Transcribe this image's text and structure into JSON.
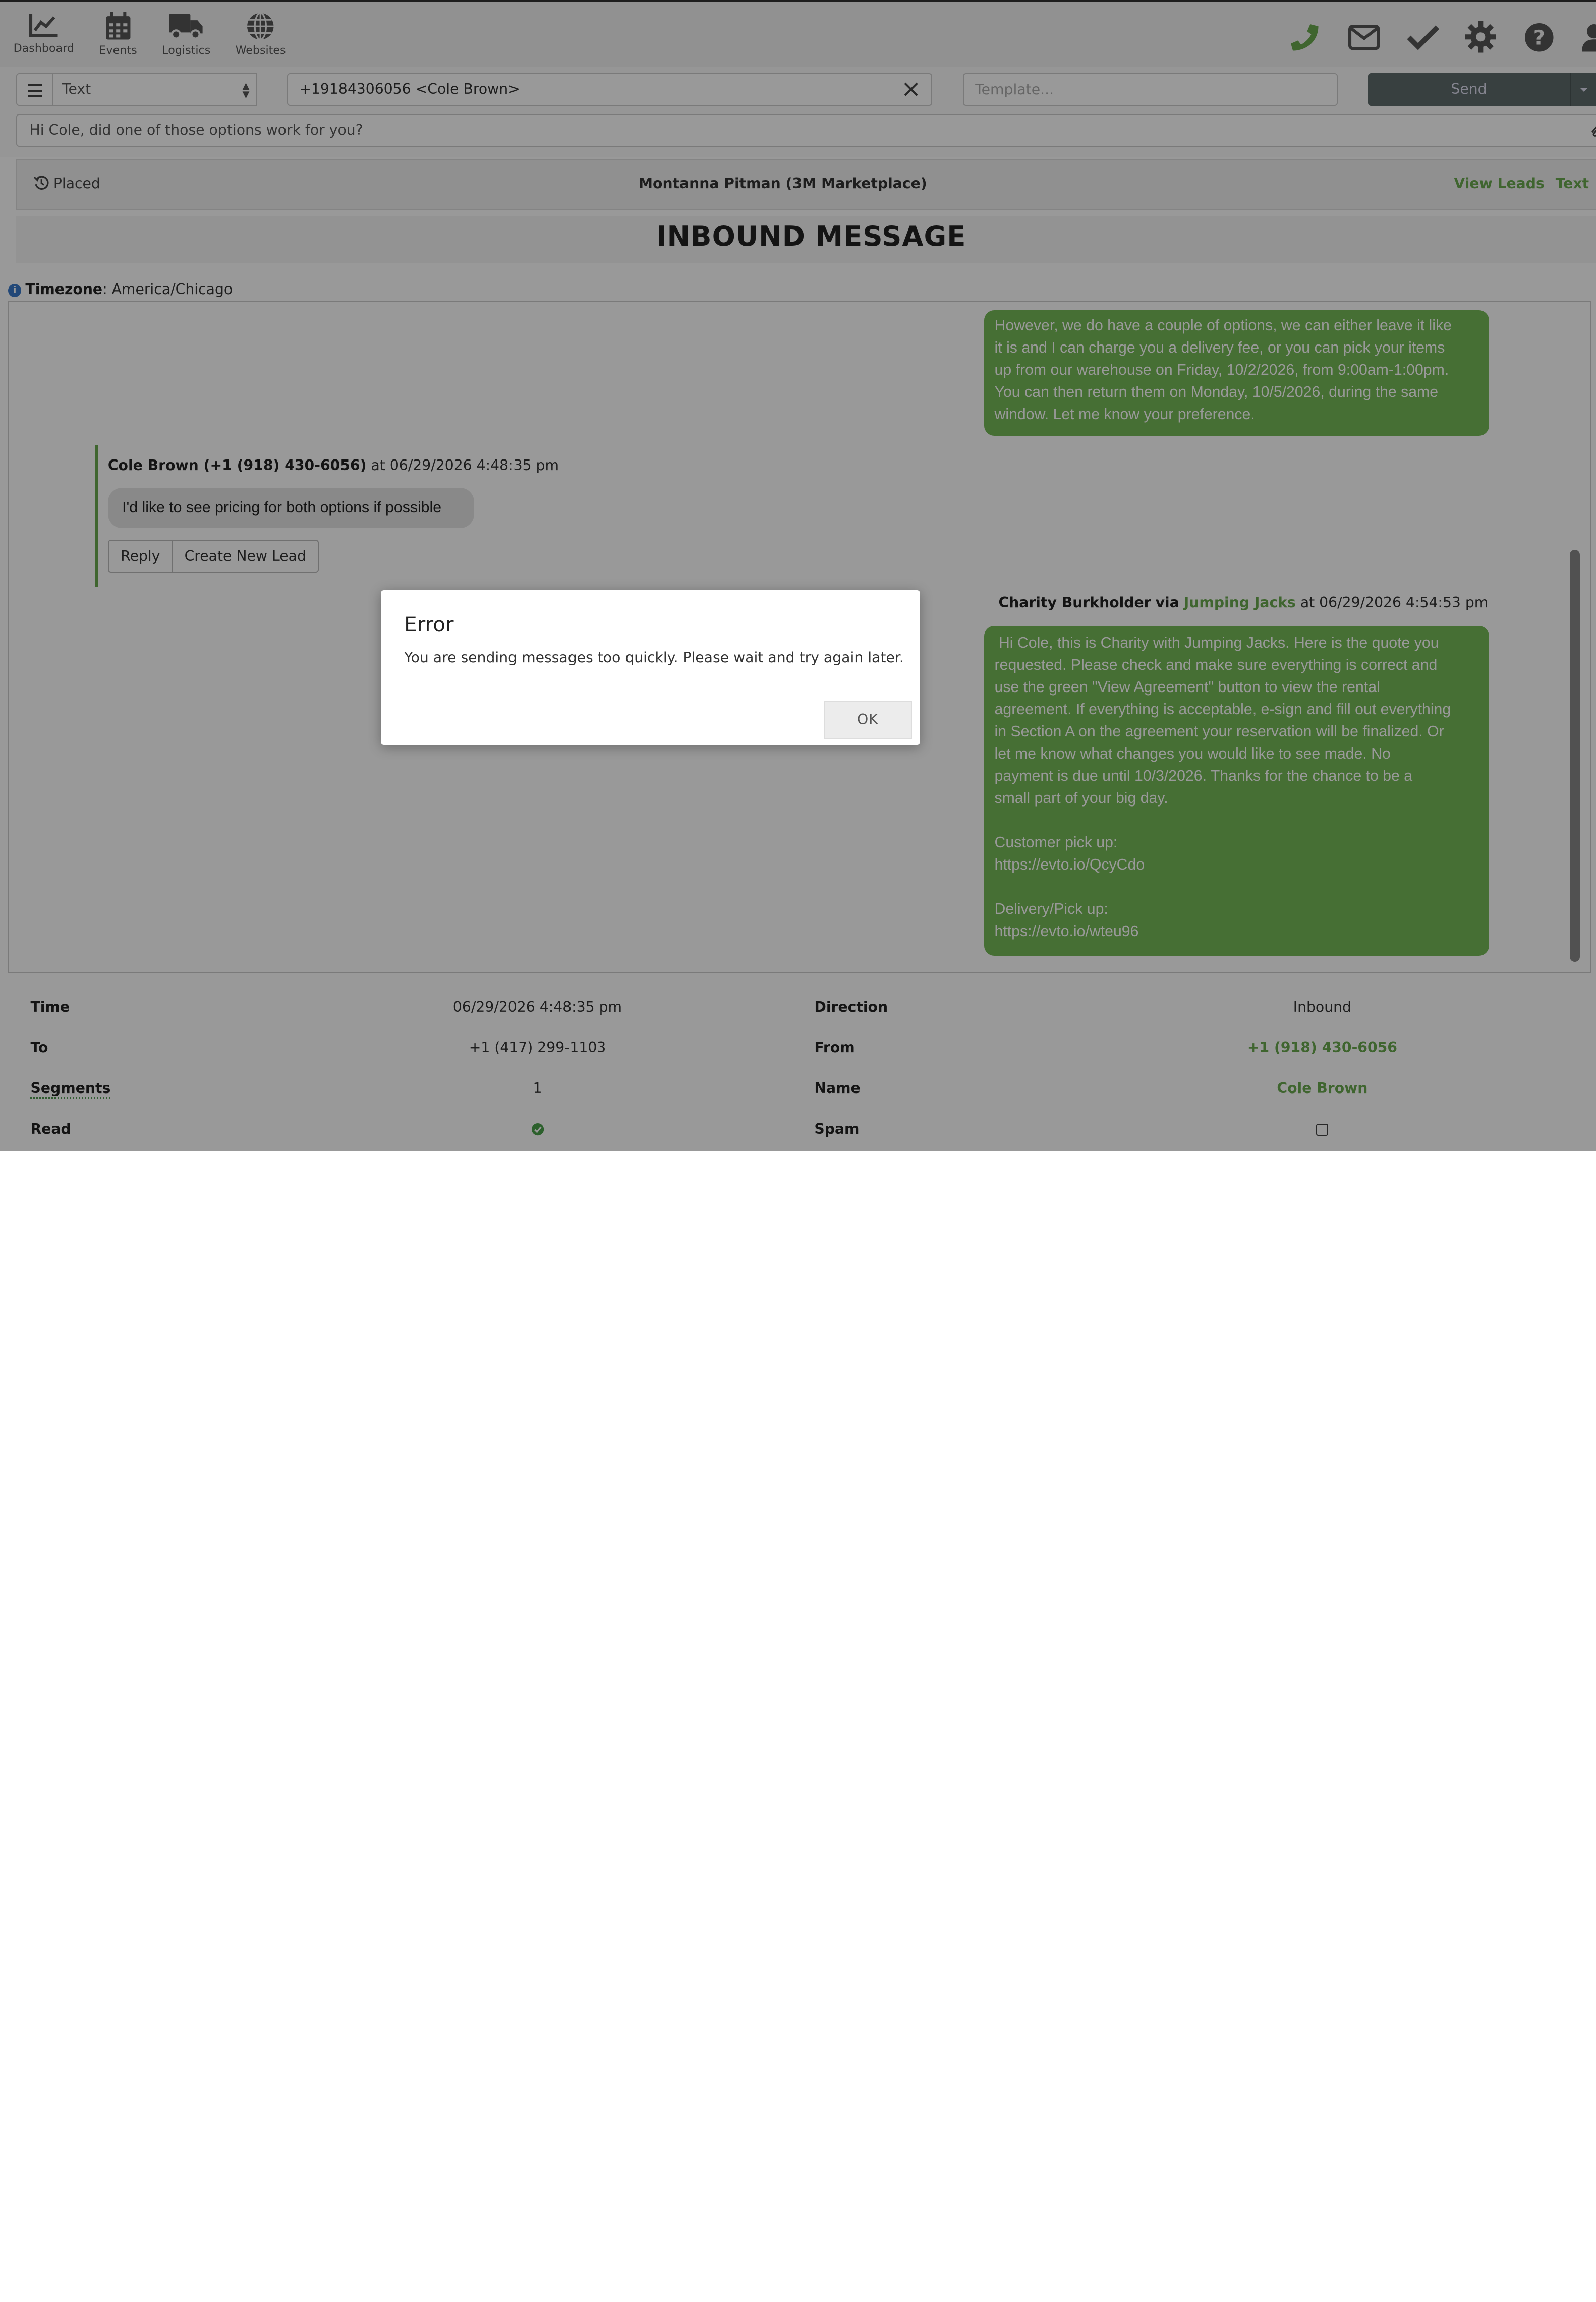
{
  "nav": {
    "items": [
      {
        "label": "Dashboard",
        "icon": "chart-line-icon"
      },
      {
        "label": "Events",
        "icon": "calendar-icon"
      },
      {
        "label": "Logistics",
        "icon": "truck-icon"
      },
      {
        "label": "Websites",
        "icon": "globe-icon"
      }
    ],
    "right_icons": [
      "phone-icon",
      "envelope-icon",
      "check-icon",
      "gear-icon",
      "question-icon",
      "user-icon"
    ],
    "accent": "#6aa84f"
  },
  "compose": {
    "type_value": "Text",
    "to_value": "+19184306056 <Cole Brown>",
    "template_placeholder": "Template...",
    "send_label": "Send",
    "message_value": "Hi Cole, did one of those options work for you?"
  },
  "lead": {
    "status": "Placed",
    "name": "Montanna Pitman (3M Marketplace)",
    "link_view_leads": "View Leads",
    "link_text": "Text"
  },
  "page_title": "INBOUND MESSAGE",
  "timezone": {
    "label": "Timezone",
    "value": "America/Chicago"
  },
  "conversation": {
    "first_outbound": [
      "However, we do have a couple of options, we can either leave it like",
      "it is and I can charge you a delivery fee, or you can pick your items",
      "up from our warehouse on Friday, 10/2/2026, from 9:00am-1:00pm.",
      "You can then return them on Monday, 10/5/2026, during the same",
      "window. Let me know your preference."
    ],
    "inbound": {
      "sender": "Cole Brown (+1 (918) 430-6056)",
      "at": "at 06/29/2026 4:48:35 pm",
      "text": "I'd like to see pricing for both options if possible",
      "reply_label": "Reply",
      "create_lead_label": "Create New Lead"
    },
    "second_outbound": {
      "sender": "Charity Burkholder",
      "via": "via",
      "business": "Jumping Jacks",
      "at": "at 06/29/2026 4:54:53 pm",
      "lines": [
        " Hi Cole, this is Charity with Jumping Jacks. Here is the quote you",
        "requested. Please check and make sure everything is correct and",
        "use the green \"View Agreement\" button to view the rental",
        "agreement. If everything is acceptable, e-sign and fill out everything",
        "in Section A on the agreement your reservation will be finalized. Or",
        "let me know what changes you would like to see made. No",
        "payment is due until 10/3/2026.  Thanks for the chance to be a",
        "small part of your big day.",
        "",
        "Customer pick up:",
        "https://evto.io/QcyCdo",
        "",
        "Delivery/Pick up:",
        "https://evto.io/wteu96"
      ]
    }
  },
  "details": {
    "time_label": "Time",
    "time_value": "06/29/2026 4:48:35 pm",
    "direction_label": "Direction",
    "direction_value": "Inbound",
    "to_label": "To",
    "to_value": "+1 (417) 299-1103",
    "from_label": "From",
    "from_value": "+1 (918) 430-6056",
    "segments_label": "Segments",
    "segments_value": "1",
    "name_label": "Name",
    "name_value": "Cole Brown",
    "read_label": "Read",
    "read_checked": true,
    "spam_label": "Spam",
    "spam_checked": false
  },
  "modal": {
    "title": "Error",
    "message": "You are sending messages too quickly. Please wait and try again later.",
    "ok_label": "OK"
  }
}
